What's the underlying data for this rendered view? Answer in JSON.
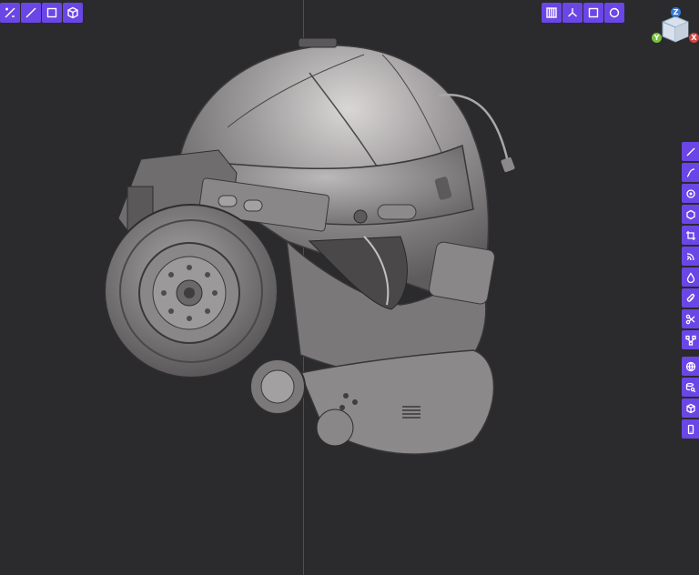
{
  "viewport": {
    "background": "#2b2a2c",
    "accent": "#6b46e6"
  },
  "top_left_toolbar": {
    "tools": [
      "measure-tool-icon",
      "line-tool-icon",
      "rectangle-tool-icon",
      "box-tool-icon"
    ]
  },
  "top_right_toolbar": {
    "tools": [
      "grid-view-icon",
      "axes-view-icon",
      "frame-view-icon",
      "shading-view-icon"
    ]
  },
  "gizmo": {
    "axes": {
      "z": "Z",
      "y": "Y",
      "x": "X"
    },
    "colors": {
      "z": "#3b7bd6",
      "y": "#7ac142",
      "x": "#d64545"
    }
  },
  "right_toolbar": {
    "group1": [
      "line-icon",
      "curve-icon",
      "circle-icon",
      "hexagon-icon",
      "crop-icon",
      "wave-icon",
      "drop-icon",
      "paperclip-icon",
      "scissors-icon",
      "node-tree-icon"
    ],
    "group2": [
      "globe-icon",
      "search-layers-icon",
      "cube-icon",
      "phone-icon"
    ]
  }
}
